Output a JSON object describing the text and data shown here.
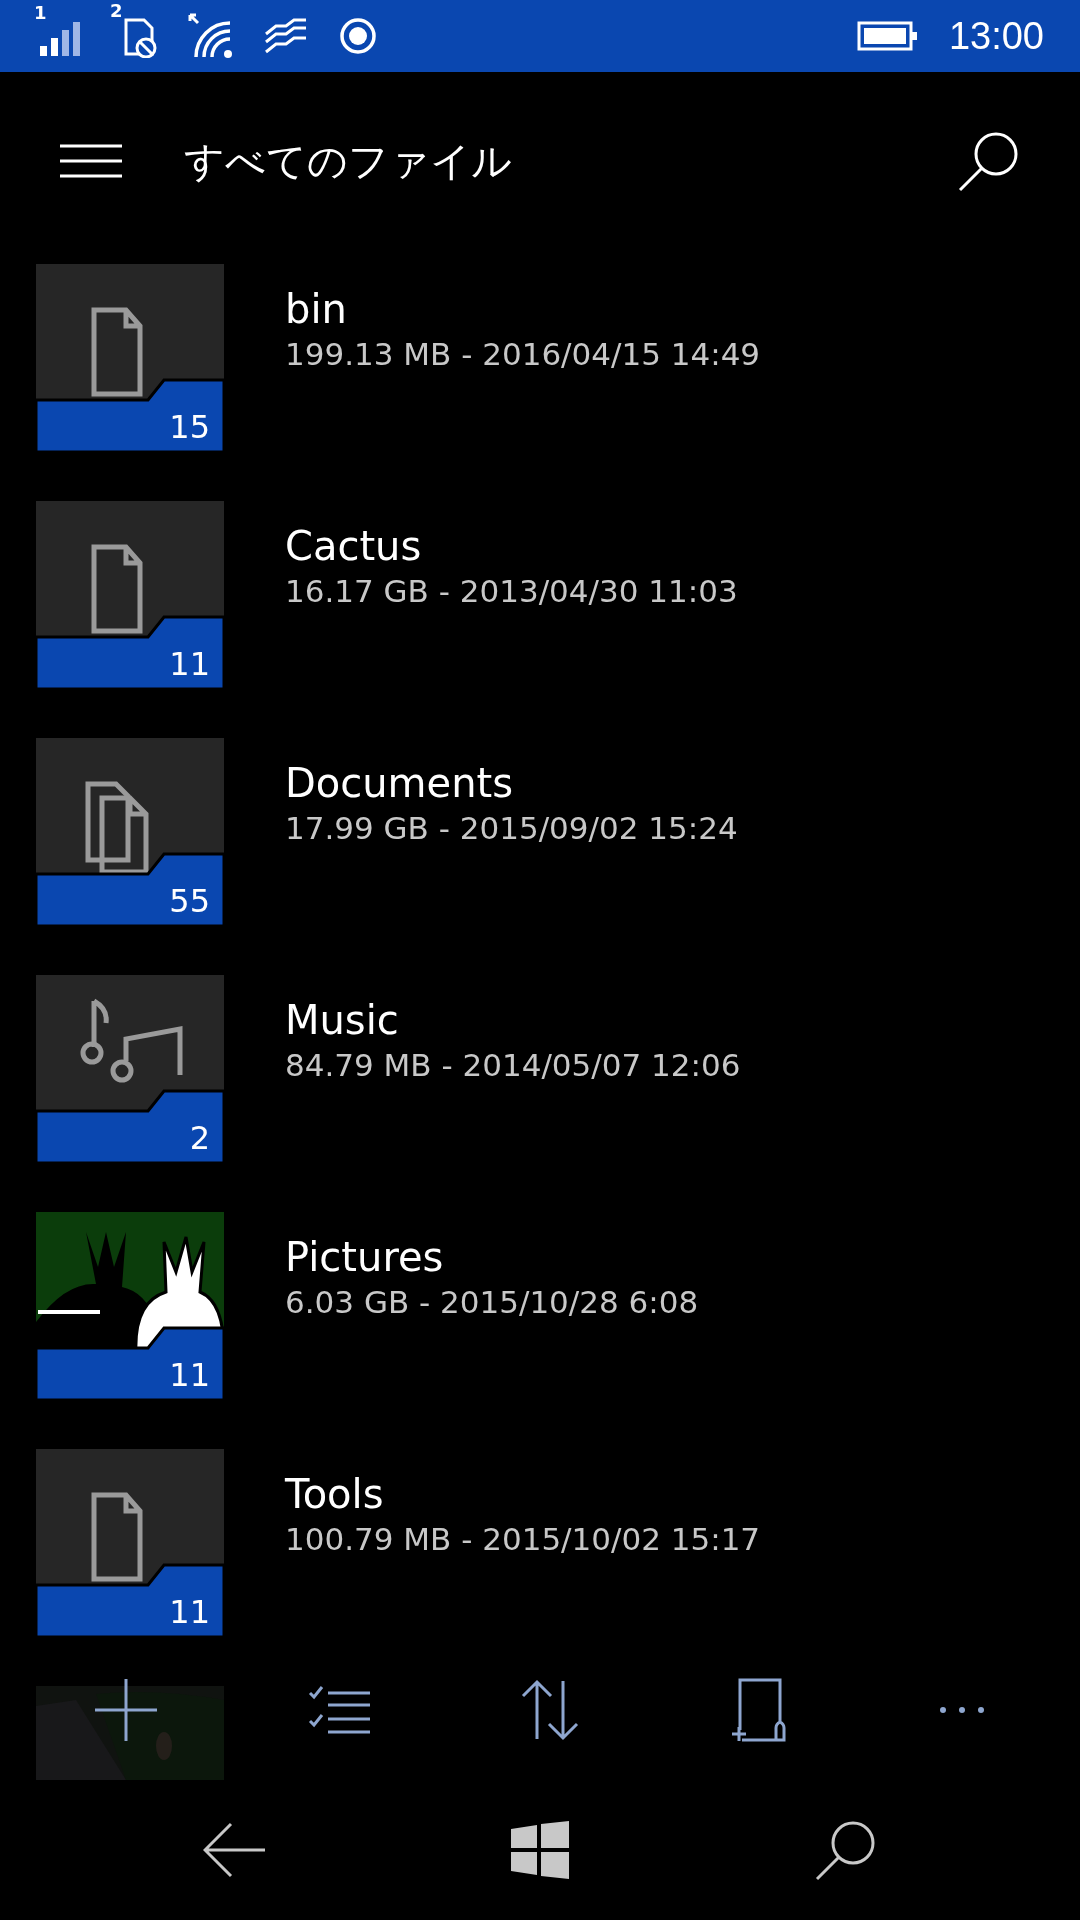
{
  "status_bar": {
    "signal_sim": "1",
    "data_sim": "2",
    "time": "13:00"
  },
  "header": {
    "title": "すべてのファイル"
  },
  "files": [
    {
      "kind": "file",
      "name": "bin",
      "details": "199.13 MB - 2016/04/15 14:49",
      "count": "15"
    },
    {
      "kind": "file",
      "name": "Cactus",
      "details": "16.17 GB - 2013/04/30 11:03",
      "count": "11"
    },
    {
      "kind": "documents",
      "name": "Documents",
      "details": "17.99 GB - 2015/09/02 15:24",
      "count": "55"
    },
    {
      "kind": "music",
      "name": "Music",
      "details": "84.79 MB - 2014/05/07 12:06",
      "count": "2"
    },
    {
      "kind": "picture",
      "name": "Pictures",
      "details": "6.03 GB - 2015/10/28 6:08",
      "count": "11"
    },
    {
      "kind": "file",
      "name": "Tools",
      "details": "100.79 MB - 2015/10/02 15:17",
      "count": "11"
    }
  ]
}
